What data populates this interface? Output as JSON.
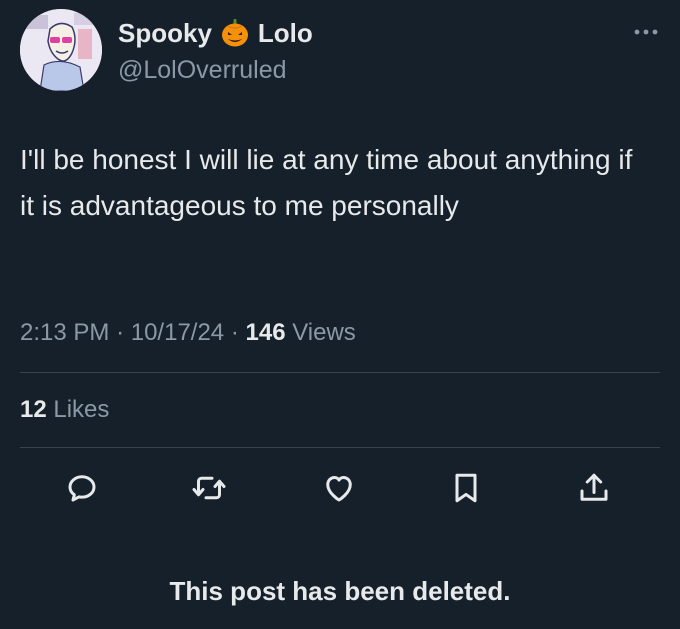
{
  "author": {
    "display_name_first": "Spooky",
    "display_name_emoji": "jack-o-lantern-emoji",
    "display_name_second": "Lolo",
    "handle": "@LolOverruled"
  },
  "tweet": {
    "text": "I'll be honest I will lie at any time about anything if it is advantageous to me personally",
    "time": "2:13 PM",
    "separator": "·",
    "date": "10/17/24",
    "views_count": "146",
    "views_label": "Views",
    "likes_count": "12",
    "likes_label": "Likes"
  },
  "actions": [
    {
      "name": "reply",
      "icon": "reply-icon"
    },
    {
      "name": "retweet",
      "icon": "retweet-icon"
    },
    {
      "name": "like",
      "icon": "heart-icon"
    },
    {
      "name": "bookmark",
      "icon": "bookmark-icon"
    },
    {
      "name": "share",
      "icon": "share-icon"
    }
  ],
  "notice": "This post has been deleted.",
  "colors": {
    "background": "#15202b",
    "text": "#e7e9ea",
    "secondary": "#8b98a5",
    "divider": "#38444d"
  }
}
